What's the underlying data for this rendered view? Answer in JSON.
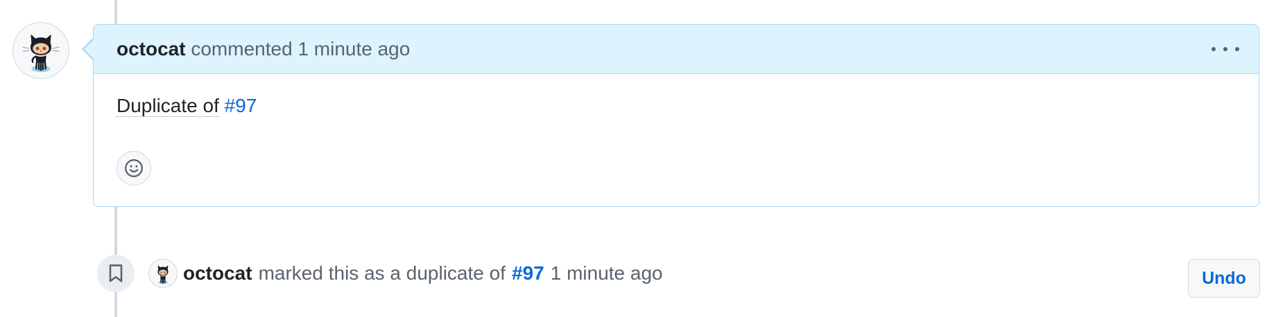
{
  "comment": {
    "author": "octocat",
    "action": "commented",
    "time": "1 minute ago",
    "body_text": "Duplicate of",
    "body_link": "#97"
  },
  "event": {
    "author": "octocat",
    "action": "marked this as a duplicate of",
    "link": "#97",
    "time": "1 minute ago"
  },
  "buttons": {
    "undo_label": "Undo"
  },
  "icons": {
    "avatar": "octocat-avatar",
    "menu": "kebab-horizontal-icon",
    "reaction": "smiley-icon",
    "event": "bookmark-icon"
  },
  "colors": {
    "header_bg": "#ddf4ff",
    "header_border": "#a7d4f7",
    "link": "#0969da",
    "muted": "#59636e",
    "timeline": "#d1d9e0"
  }
}
